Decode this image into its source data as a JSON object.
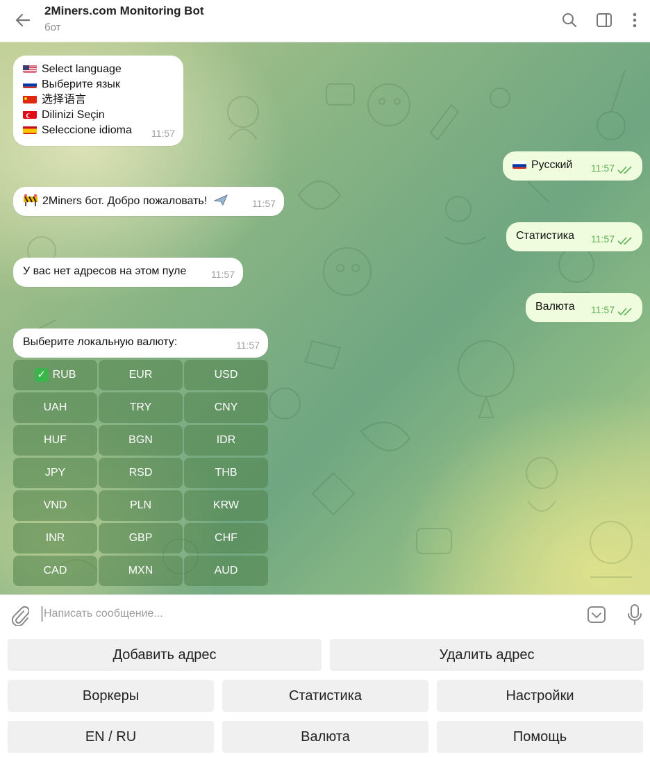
{
  "header": {
    "title": "2Miners.com Monitoring Bot",
    "subtitle": "бот"
  },
  "messages": {
    "lang": {
      "lines": [
        "Select language",
        "Выберите язык",
        "选择语言",
        "Dilinizi Seçin",
        "Seleccione idioma"
      ],
      "time": "11:57"
    },
    "russian": {
      "text": "Русский",
      "time": "11:57"
    },
    "welcome": {
      "text": "2Miners бот. Добро пожаловать!",
      "time": "11:57"
    },
    "stats": {
      "text": "Статистика",
      "time": "11:57"
    },
    "noaddr": {
      "text": "У вас нет адресов на этом пуле",
      "time": "11:57"
    },
    "currency": {
      "text": "Валюта",
      "time": "11:57"
    },
    "choose": {
      "text": "Выберите локальную валюту:",
      "time": "11:57"
    }
  },
  "currency_keyboard": [
    "RUB",
    "EUR",
    "USD",
    "UAH",
    "TRY",
    "CNY",
    "HUF",
    "BGN",
    "IDR",
    "JPY",
    "RSD",
    "THB",
    "VND",
    "PLN",
    "KRW",
    "INR",
    "GBP",
    "CHF",
    "CAD",
    "MXN",
    "AUD"
  ],
  "input": {
    "placeholder": "Написать сообщение..."
  },
  "reply_keyboard": {
    "add_address": "Добавить адрес",
    "delete_address": "Удалить адрес",
    "workers": "Воркеры",
    "statistics": "Статистика",
    "settings": "Настройки",
    "lang_toggle": "EN / RU",
    "currency": "Валюта",
    "help": "Помощь"
  },
  "colors": {
    "out_bubble": "#effdde",
    "time_out": "#5eaf56",
    "check": "#39b54a"
  }
}
